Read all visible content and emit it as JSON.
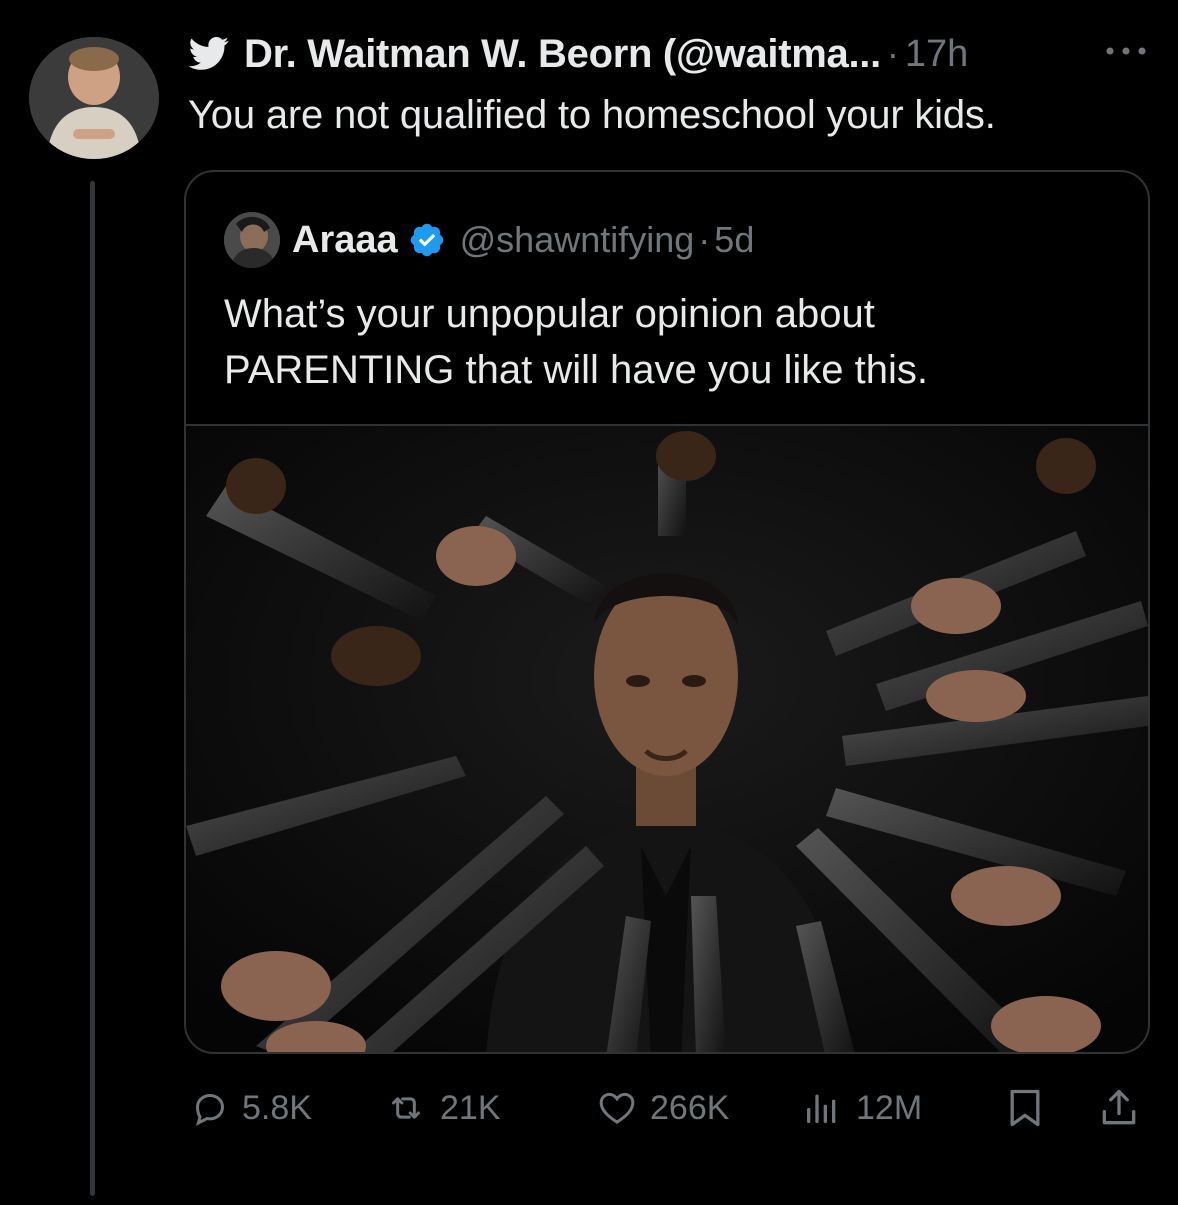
{
  "tweet": {
    "author": "Dr. Waitman W. Beorn (@waitma...",
    "dot": "·",
    "time": "17h",
    "text": "You are not qualified to homeschool your kids."
  },
  "quote": {
    "name": "Araaa",
    "handle": "@shawntifying",
    "dot": "·",
    "time": "5d",
    "text_line1": "What’s your unpopular opinion about",
    "text_line2": "PARENTING that will have you like this."
  },
  "actions": {
    "replies": "5.8K",
    "retweets": "21K",
    "likes": "266K",
    "views": "12M"
  },
  "icons": {
    "brand": "twitter-bird-icon",
    "more": "more-icon",
    "verified": "verified-badge-icon",
    "reply": "reply-icon",
    "retweet": "retweet-icon",
    "like": "heart-icon",
    "views": "views-icon",
    "bookmark": "bookmark-icon",
    "share": "share-icon"
  },
  "colors": {
    "background": "#000000",
    "text": "#e7e9ea",
    "muted": "#71767b",
    "border": "#2f3336",
    "verified": "#1d9bf0"
  }
}
